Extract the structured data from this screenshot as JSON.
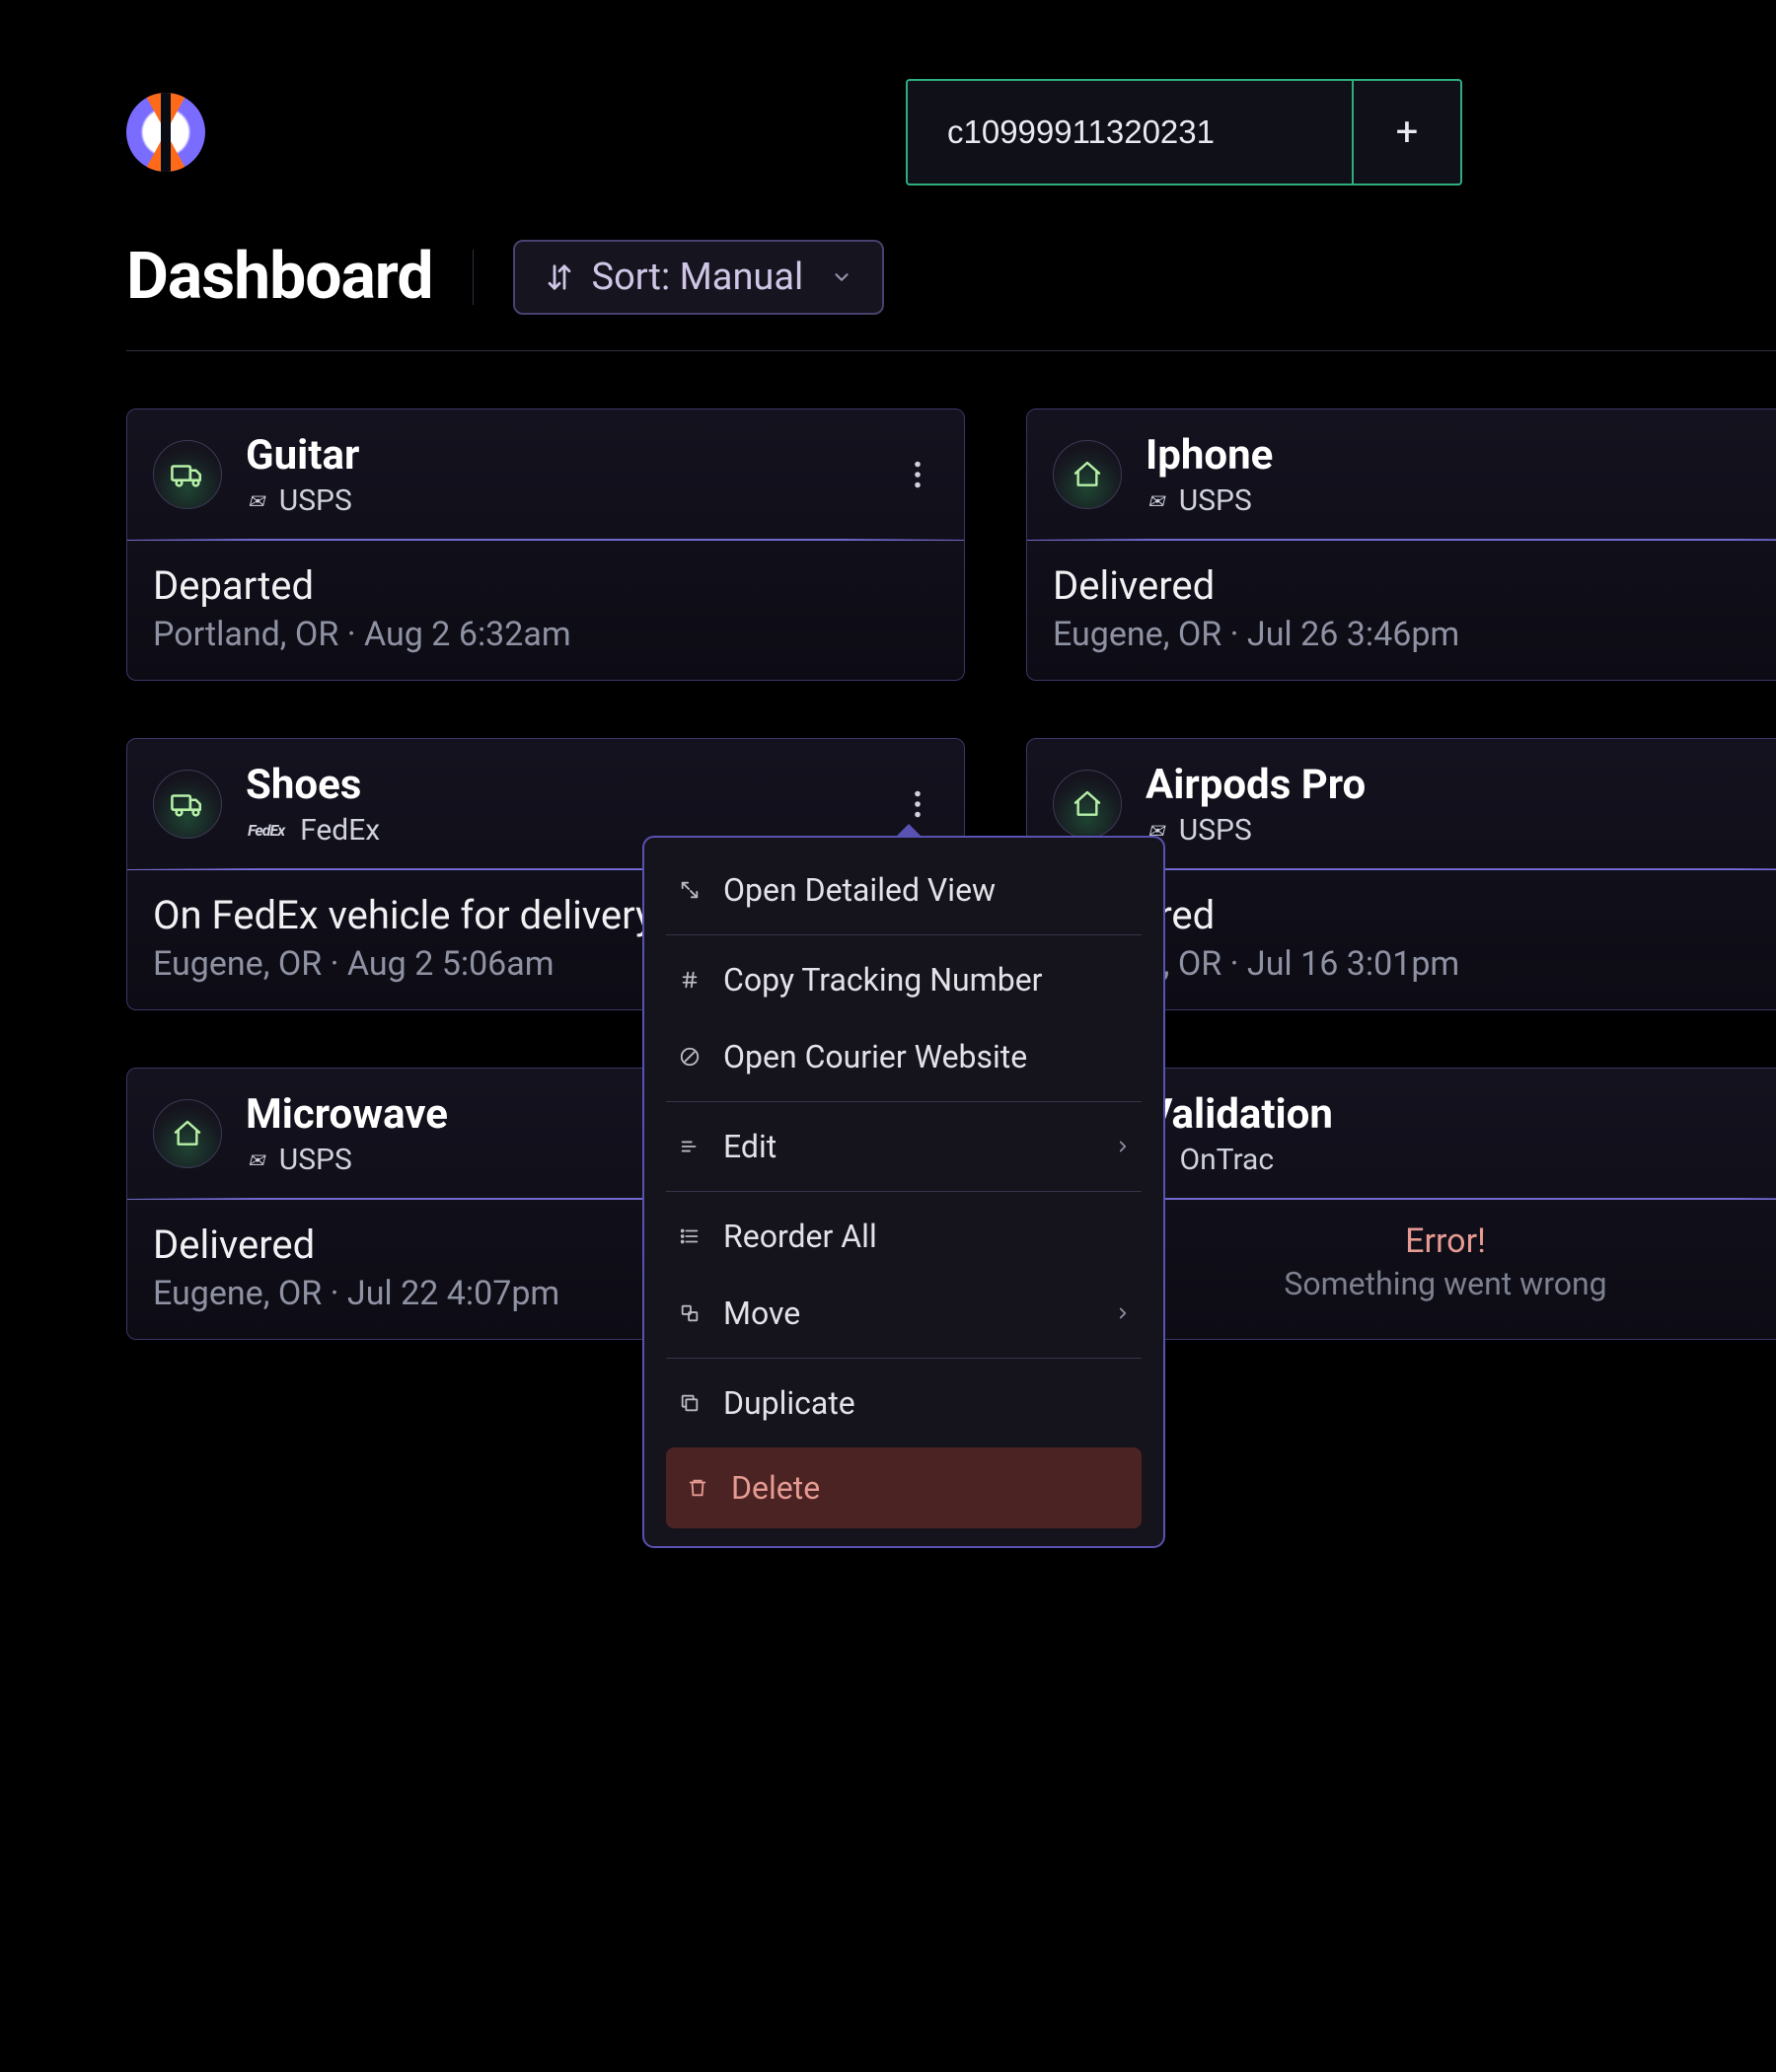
{
  "header": {
    "title": "Dashboard",
    "sort_label": "Sort: Manual"
  },
  "search": {
    "value": "c10999911320231"
  },
  "cards": [
    {
      "name": "Guitar",
      "carrier": "USPS",
      "icon": "truck",
      "status": "Departed",
      "meta": "Portland, OR · Aug 2 6:32am"
    },
    {
      "name": "Iphone",
      "carrier": "USPS",
      "icon": "home",
      "status": "Delivered",
      "meta": "Eugene, OR · Jul 26 3:46pm"
    },
    {
      "name": "Shoes",
      "carrier": "FedEx",
      "icon": "truck",
      "status": "On FedEx vehicle for delivery",
      "meta": "Eugene, OR · Aug 2 5:06am"
    },
    {
      "name": "Airpods Pro",
      "carrier": "USPS",
      "icon": "home",
      "status": "Delivered",
      "meta": "Eugene, OR · Jul 16 3:01pm"
    },
    {
      "name": "Microwave",
      "carrier": "USPS",
      "icon": "home",
      "status": "Delivered",
      "meta": "Eugene, OR · Jul 22 4:07pm"
    },
    {
      "name": "Validation",
      "carrier": "OnTrac",
      "icon": "home",
      "error_title": "Error!",
      "error_sub": "Something went wrong"
    }
  ],
  "menu": {
    "open_detailed": "Open Detailed View",
    "copy_tracking": "Copy Tracking Number",
    "open_courier": "Open Courier Website",
    "edit": "Edit",
    "reorder": "Reorder All",
    "move": "Move",
    "duplicate": "Duplicate",
    "delete": "Delete"
  }
}
